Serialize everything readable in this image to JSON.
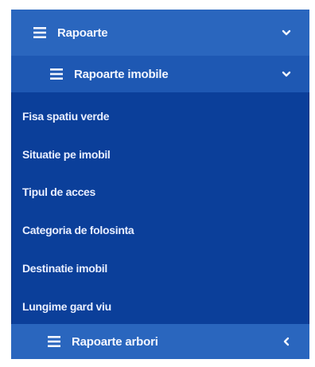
{
  "menu": {
    "top": {
      "label": "Rapoarte",
      "icon": "hamburger-icon",
      "chevron": "chevron-down-icon"
    },
    "submenu": {
      "label": "Rapoarte imobile",
      "icon": "hamburger-icon",
      "chevron": "chevron-down-icon"
    },
    "items": [
      {
        "label": "Fisa spatiu verde"
      },
      {
        "label": "Situatie pe imobil"
      },
      {
        "label": "Tipul de acces"
      },
      {
        "label": "Categoria de folosinta"
      },
      {
        "label": "Destinatie imobil"
      },
      {
        "label": "Lungime gard viu"
      }
    ],
    "bottom": {
      "label": "Rapoarte arbori",
      "icon": "hamburger-icon",
      "chevron": "chevron-left-icon"
    }
  },
  "colors": {
    "panel": "#0b3f9a",
    "header": "#2a66be",
    "subheader": "#1e58b3",
    "text": "#f2f6ff"
  }
}
